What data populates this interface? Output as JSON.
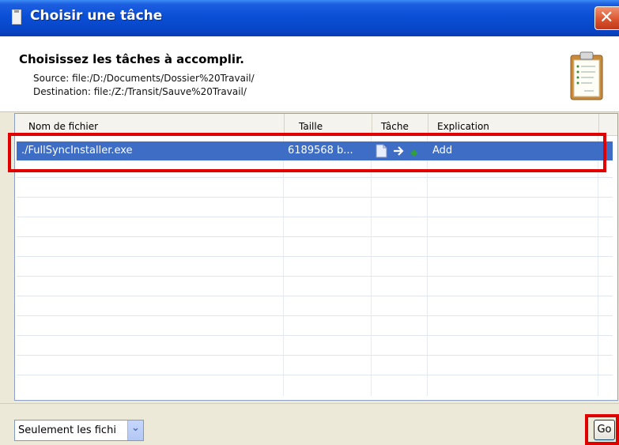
{
  "window": {
    "title": "Choisir une tâche"
  },
  "header": {
    "heading": "Choisissez les tâches à accomplir.",
    "source_line": "Source: file:/D:/Documents/Dossier%20Travail/",
    "destination_line": "Destination: file:/Z:/Transit/Sauve%20Travail/"
  },
  "table": {
    "columns": [
      "Nom de fichier",
      "Taille",
      "Tâche",
      "Explication"
    ],
    "rows": [
      {
        "file": "./FullSyncInstaller.exe",
        "size": "6189568 b...",
        "task_icons": [
          "file-icon",
          "arrow-right-icon",
          "plus-icon"
        ],
        "explanation": "Add"
      }
    ]
  },
  "footer": {
    "filter_value": "Seulement les fichi",
    "go_label": "Go"
  },
  "colors": {
    "titlebar": "#0a4fd6",
    "selection": "#3d6dc5",
    "highlight": "#e00000"
  }
}
